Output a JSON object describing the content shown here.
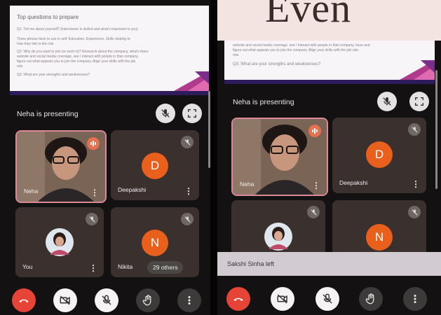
{
  "left": {
    "slide": {
      "title": "Top questions to prepare",
      "lines": [
        "Q1: Tell me about yourself? (Interviewer is skilled and what's important to you)",
        "Three phrase facts to use in self: Education, Experience, Skills relating to",
        "how they link to the role",
        "Q2: Why do you want to join (or work in)? Research about the company, what's there",
        "website and social media coverage, see / interact with people in that company,",
        "figure out what appeals you to join the company. Align your skills with the job",
        "role.",
        "Q3: What are your strengths and weaknesses?"
      ]
    },
    "presenting_label": "Neha is presenting",
    "tiles": [
      {
        "name": "Neha",
        "type": "video"
      },
      {
        "name": "Deepakshi",
        "letter": "D"
      },
      {
        "name": "You",
        "type": "photo"
      },
      {
        "name": "Nikita",
        "letter": "N"
      }
    ],
    "others_label": "29 others"
  },
  "right": {
    "banner_text": "Even",
    "slide": {
      "lines": [
        "website and social media coverage, see / interact with people in that company, have and",
        "figure out what appeals you to join the company. Align your skills with the job role.",
        "role.",
        "Q3: What are your strengths and weaknesses?"
      ]
    },
    "presenting_label": "Neha is presenting",
    "tiles": [
      {
        "name": "Neha",
        "type": "video"
      },
      {
        "name": "Deepakshi",
        "letter": "D"
      },
      {
        "name": "",
        "type": "photo"
      },
      {
        "name": "",
        "letter": "N"
      }
    ],
    "toast": "Sakshi Sinha left"
  },
  "colors": {
    "accent_red": "#e64437",
    "avatar_orange": "#e8601b",
    "tile_bg": "#3a312f"
  },
  "icons": [
    "mic-off-icon",
    "fullscreen-icon",
    "end-call-icon",
    "camera-off-icon",
    "hand-raise-icon",
    "more-vert-icon",
    "speaking-icon"
  ]
}
